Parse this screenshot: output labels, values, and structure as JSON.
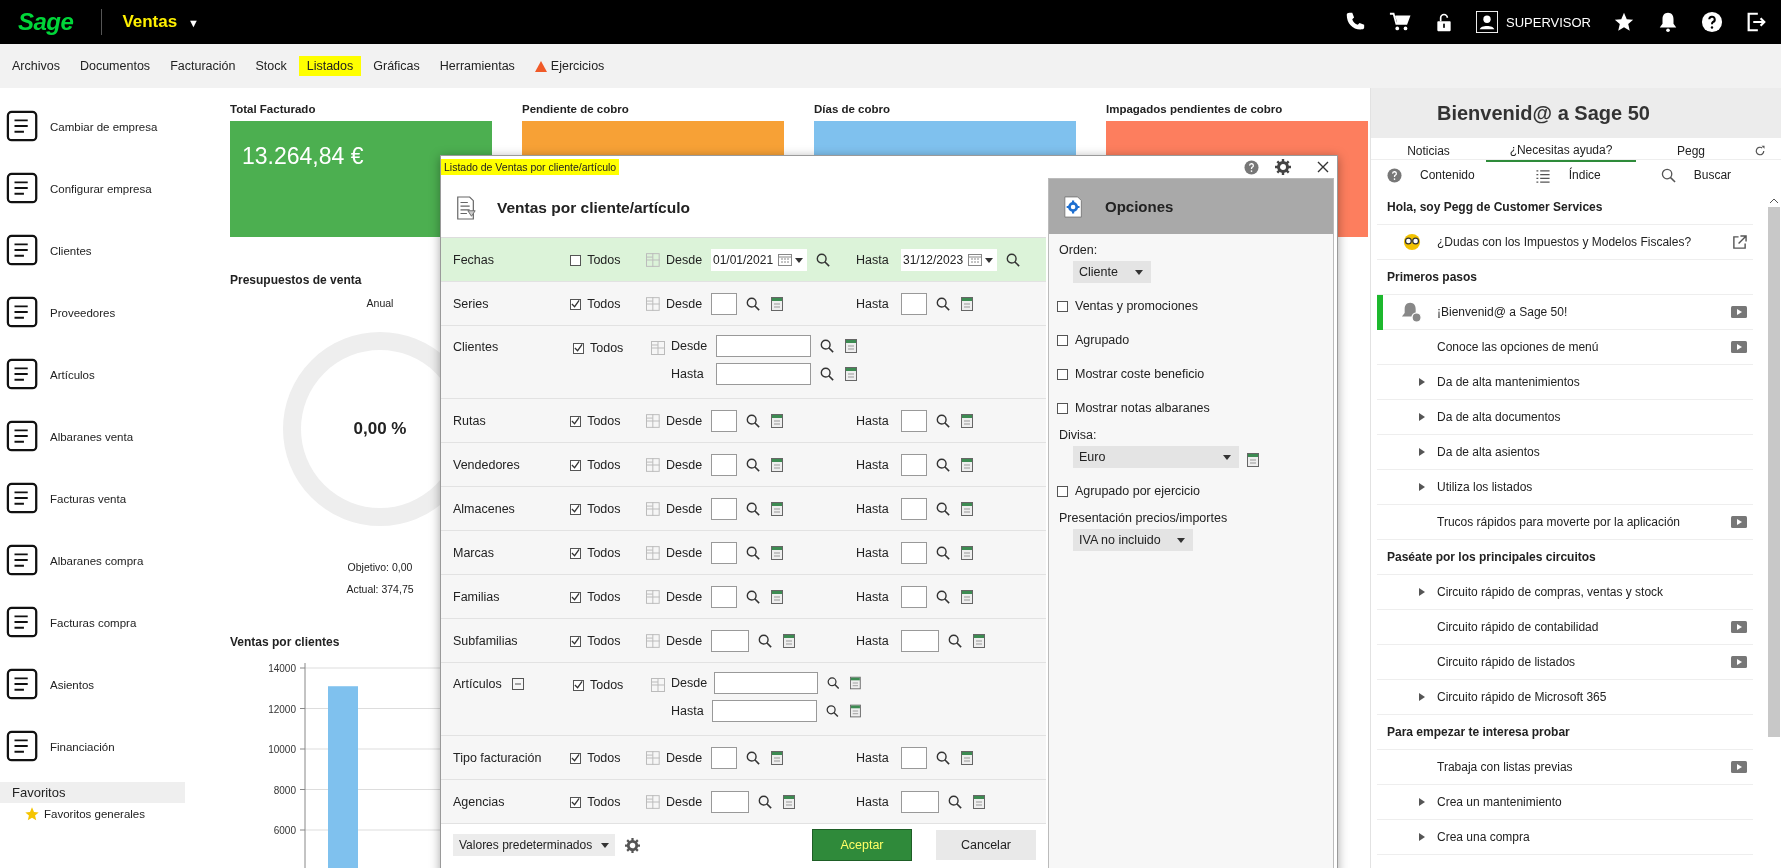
{
  "app": {
    "logo": "Sage",
    "module": "Ventas",
    "module_caret": "▼",
    "user": "SUPERVISOR"
  },
  "menu": [
    {
      "label": "Archivos",
      "selected": false,
      "kind": "plain"
    },
    {
      "label": "Documentos",
      "selected": false,
      "kind": "plain"
    },
    {
      "label": "Facturación",
      "selected": false,
      "kind": "plain"
    },
    {
      "label": "Stock",
      "selected": false,
      "kind": "plain"
    },
    {
      "label": "Listados",
      "selected": true,
      "kind": "plain"
    },
    {
      "label": "Gráficas",
      "selected": false,
      "kind": "plain"
    },
    {
      "label": "Herramientas",
      "selected": false,
      "kind": "plain"
    },
    {
      "label": "Ejercicios",
      "selected": false,
      "kind": "warning"
    }
  ],
  "sidebar": {
    "items": [
      "Cambiar de empresa",
      "Configurar empresa",
      "Clientes",
      "Proveedores",
      "Artículos",
      "Albaranes venta",
      "Facturas venta",
      "Albaranes compra",
      "Facturas compra",
      "Asientos",
      "Financiación"
    ],
    "favorites": {
      "title": "Favoritos",
      "items": [
        "Favoritos generales"
      ]
    }
  },
  "dashboard": {
    "cards": [
      {
        "title": "Total Facturado",
        "value": "13.264,84 €",
        "color": "#4caf50"
      },
      {
        "title": "Pendiente de cobro",
        "color": "#f7a136"
      },
      {
        "title": "Días de cobro",
        "color": "#7fc1ee"
      },
      {
        "title": "Impagados pendientes de cobro",
        "color": "#fd7e5e"
      }
    ],
    "budget": {
      "title": "Presupuestos de venta",
      "period": "Anual",
      "level": 0,
      "percent": "0,00 %",
      "target": "Objetivo: 0,00",
      "actual": "Actual: 374,75"
    },
    "sales": {
      "title": "Ventas por clientes",
      "chart_data": {
        "type": "bar",
        "categories": [
          null
        ],
        "values": [
          13100
        ],
        "ylim": [
          0,
          14000
        ],
        "yticks": [
          6000,
          8000,
          10000,
          12000,
          14000
        ],
        "grid": true
      }
    }
  },
  "dialog": {
    "title": "Listado de Ventas por cliente/artículo",
    "heading": "Ventas por cliente/artículo",
    "rows": [
      {
        "label": "Fechas",
        "kind": "date",
        "selected": true,
        "all_label": "Todos",
        "all_checked": false,
        "from_label": "Desde",
        "from_value": "01/01/2021",
        "to_label": "Hasta",
        "to_value": "31/12/2023"
      },
      {
        "label": "Series",
        "kind": "range",
        "selected": false,
        "all_label": "Todos",
        "all_checked": true,
        "from_label": "Desde",
        "to_label": "Hasta"
      },
      {
        "label": "Clientes",
        "kind": "stacked",
        "selected": false,
        "all_label": "Todos",
        "all_checked": true,
        "from_label": "Desde",
        "to_label": "Hasta"
      },
      {
        "label": "Rutas",
        "kind": "range",
        "selected": false,
        "all_label": "Todos",
        "all_checked": true,
        "from_label": "Desde",
        "to_label": "Hasta"
      },
      {
        "label": "Vendedores",
        "kind": "range",
        "selected": false,
        "all_label": "Todos",
        "all_checked": true,
        "from_label": "Desde",
        "to_label": "Hasta"
      },
      {
        "label": "Almacenes",
        "kind": "range",
        "selected": false,
        "all_label": "Todos",
        "all_checked": true,
        "from_label": "Desde",
        "to_label": "Hasta"
      },
      {
        "label": "Marcas",
        "kind": "range",
        "selected": false,
        "all_label": "Todos",
        "all_checked": true,
        "from_label": "Desde",
        "to_label": "Hasta"
      },
      {
        "label": "Familias",
        "kind": "range",
        "selected": false,
        "all_label": "Todos",
        "all_checked": true,
        "from_label": "Desde",
        "to_label": "Hasta"
      },
      {
        "label": "Subfamilias",
        "kind": "range",
        "selected": false,
        "all_label": "Todos",
        "all_checked": true,
        "from_label": "Desde",
        "to_label": "Hasta"
      },
      {
        "label": "Artículos",
        "kind": "stacked-tree",
        "selected": false,
        "all_label": "Todos",
        "all_checked": true,
        "from_label": "Desde",
        "to_label": "Hasta"
      },
      {
        "label": "Tipo facturación",
        "kind": "range",
        "selected": false,
        "all_label": "Todos",
        "all_checked": true,
        "from_label": "Desde",
        "to_label": "Hasta"
      },
      {
        "label": "Agencias",
        "kind": "range",
        "selected": false,
        "all_label": "Todos",
        "all_checked": true,
        "from_label": "Desde",
        "to_label": "Hasta"
      }
    ],
    "footer": {
      "preset": "Valores predeterminados",
      "accept": "Aceptar",
      "cancel": "Cancelar"
    },
    "options": {
      "title": "Opciones",
      "items": [
        {
          "kind": "label",
          "text": "Orden:"
        },
        {
          "kind": "select",
          "text": "Cliente"
        },
        {
          "kind": "checkbox",
          "text": "Ventas y promociones",
          "checked": false
        },
        {
          "kind": "checkbox",
          "text": "Agrupado",
          "checked": false
        },
        {
          "kind": "checkbox",
          "text": "Mostrar coste beneficio",
          "checked": false
        },
        {
          "kind": "checkbox",
          "text": "Mostrar notas albaranes",
          "checked": false
        },
        {
          "kind": "label",
          "text": "Divisa:"
        },
        {
          "kind": "select-lookup",
          "text": "Euro"
        },
        {
          "kind": "checkbox",
          "text": "Agrupado por ejercicio",
          "checked": false
        },
        {
          "kind": "label",
          "text": "Presentación precios/importes"
        },
        {
          "kind": "select",
          "text": "IVA no incluido"
        }
      ]
    }
  },
  "help": {
    "title": "Bienvenid@ a Sage 50",
    "tabs": [
      {
        "label": "Noticias",
        "selected": false
      },
      {
        "label": "¿Necesitas ayuda?",
        "selected": true
      },
      {
        "label": "Pegg",
        "selected": false
      }
    ],
    "tools": [
      {
        "label": "Contenido",
        "kind": "help"
      },
      {
        "label": "Índice",
        "kind": "index"
      },
      {
        "label": "Buscar",
        "kind": "search"
      }
    ],
    "sections": [
      {
        "title": "Hola, soy Pegg de Customer Services",
        "items": [
          {
            "text": "¿Dudas con los Impuestos y Modelos Fiscales?",
            "kind": "external",
            "video": false
          }
        ]
      },
      {
        "title": "Primeros pasos",
        "items": [
          {
            "text": "¡Bienvenid@ a Sage 50!",
            "kind": "current",
            "video": true
          },
          {
            "text": "Conoce las opciones de menú",
            "kind": "plain",
            "video": true
          },
          {
            "text": "Da de alta mantenimientos",
            "kind": "expand",
            "video": false
          },
          {
            "text": "Da de alta documentos",
            "kind": "expand",
            "video": false
          },
          {
            "text": "Da de alta asientos",
            "kind": "expand",
            "video": false
          },
          {
            "text": "Utiliza los listados",
            "kind": "expand",
            "video": false
          },
          {
            "text": "Trucos rápidos para moverte por la aplicación",
            "kind": "plain",
            "video": true
          }
        ]
      },
      {
        "title": "Paséate por los principales circuitos",
        "items": [
          {
            "text": "Circuito rápido de compras, ventas y stock",
            "kind": "expand",
            "video": false
          },
          {
            "text": "Circuito rápido de contabilidad",
            "kind": "plain",
            "video": true
          },
          {
            "text": "Circuito rápido de listados",
            "kind": "plain",
            "video": true
          },
          {
            "text": "Circuito rápido de Microsoft 365",
            "kind": "expand",
            "video": false
          }
        ]
      },
      {
        "title": "Para empezar te interesa probar",
        "items": [
          {
            "text": "Trabaja con listas previas",
            "kind": "plain",
            "video": true
          },
          {
            "text": "Crea un mantenimiento",
            "kind": "expand",
            "video": false
          },
          {
            "text": "Crea una compra",
            "kind": "expand",
            "video": false
          }
        ]
      }
    ]
  }
}
